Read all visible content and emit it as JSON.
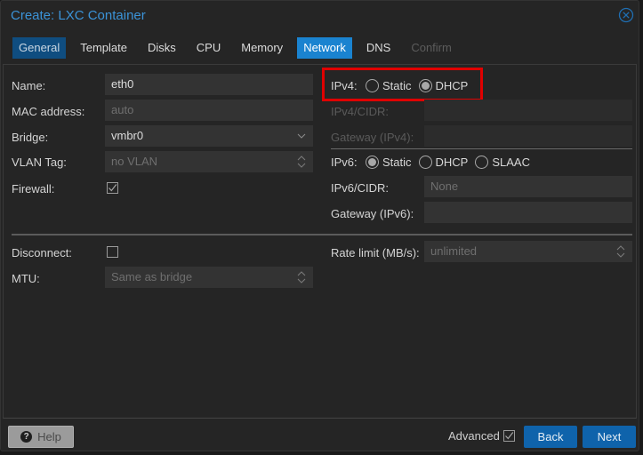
{
  "window": {
    "title": "Create: LXC Container"
  },
  "tabs": [
    {
      "label": "General",
      "state": "visited"
    },
    {
      "label": "Template",
      "state": "normal"
    },
    {
      "label": "Disks",
      "state": "normal"
    },
    {
      "label": "CPU",
      "state": "normal"
    },
    {
      "label": "Memory",
      "state": "normal"
    },
    {
      "label": "Network",
      "state": "active"
    },
    {
      "label": "DNS",
      "state": "normal"
    },
    {
      "label": "Confirm",
      "state": "disabled"
    }
  ],
  "left": {
    "name": {
      "label": "Name:",
      "value": "eth0"
    },
    "mac": {
      "label": "MAC address:",
      "placeholder": "auto"
    },
    "bridge": {
      "label": "Bridge:",
      "value": "vmbr0"
    },
    "vlan": {
      "label": "VLAN Tag:",
      "placeholder": "no VLAN"
    },
    "firewall": {
      "label": "Firewall:",
      "checked": true
    }
  },
  "right": {
    "ipv4": {
      "label": "IPv4:",
      "options": [
        "Static",
        "DHCP"
      ],
      "selected": "DHCP"
    },
    "ipv4_cidr": {
      "label": "IPv4/CIDR:",
      "value": ""
    },
    "gateway_v4": {
      "label": "Gateway (IPv4):",
      "value": ""
    },
    "ipv6": {
      "label": "IPv6:",
      "options": [
        "Static",
        "DHCP",
        "SLAAC"
      ],
      "selected": "Static"
    },
    "ipv6_cidr": {
      "label": "IPv6/CIDR:",
      "placeholder": "None"
    },
    "gateway_v6": {
      "label": "Gateway (IPv6):",
      "value": ""
    }
  },
  "advanced_section": {
    "disconnect": {
      "label": "Disconnect:",
      "checked": false
    },
    "mtu": {
      "label": "MTU:",
      "placeholder": "Same as bridge"
    },
    "rate_limit": {
      "label": "Rate limit (MB/s):",
      "placeholder": "unlimited"
    }
  },
  "footer": {
    "help_label": "Help",
    "advanced_label": "Advanced",
    "advanced_checked": true,
    "back_label": "Back",
    "next_label": "Next"
  },
  "colors": {
    "accent": "#1a83d0",
    "title": "#3b93d8",
    "highlight": "#e00000",
    "button_primary": "#0f63ab"
  }
}
